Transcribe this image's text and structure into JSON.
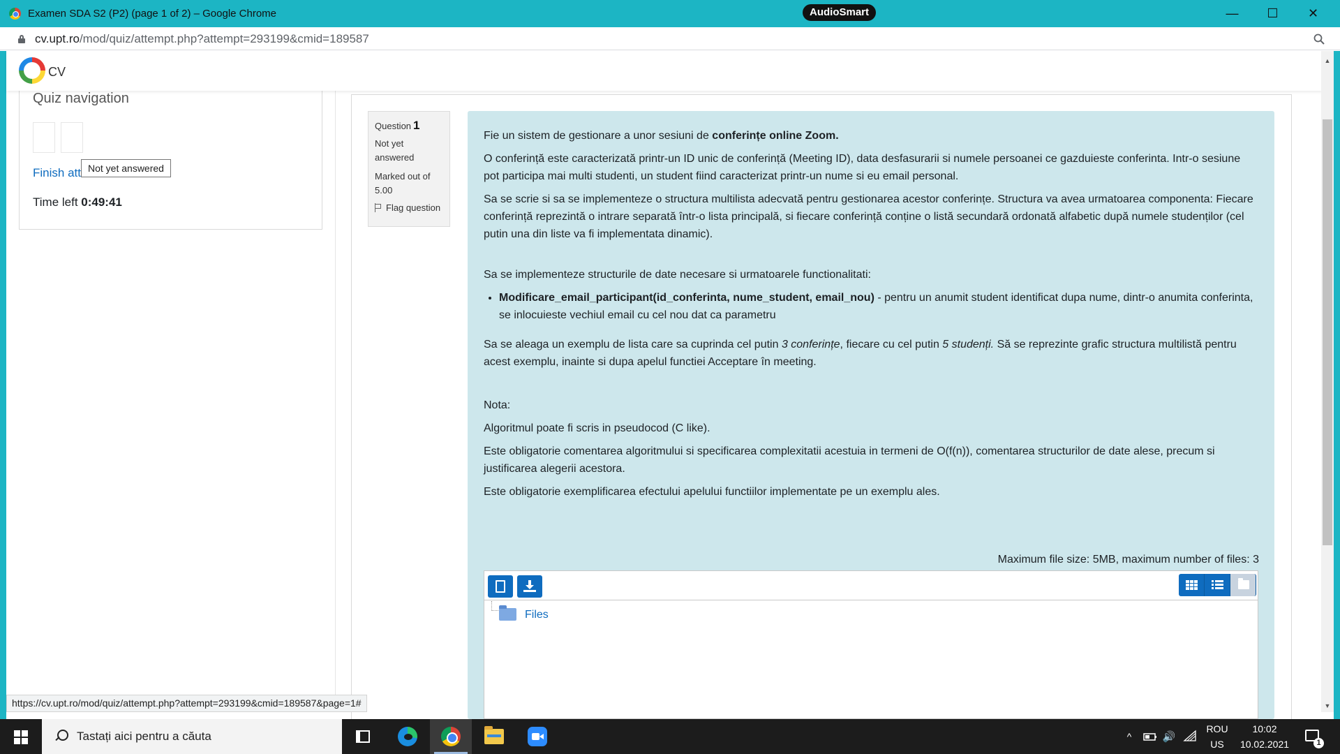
{
  "window": {
    "title": "Examen SDA S2 (P2) (page 1 of 2) – Google Chrome",
    "audiosmart": "AudioSmart",
    "minimize": "—",
    "maximize": "☐",
    "close": "✕"
  },
  "address": {
    "host": "cv.upt.ro",
    "path": "/mod/quiz/attempt.php?attempt=293199&cmid=189587"
  },
  "site": {
    "name": "CV"
  },
  "quiz_nav": {
    "heading": "Quiz navigation",
    "finish_label": "Finish attempt ...",
    "tooltip": "Not yet answered",
    "time_left_label": "Time left",
    "time_left_value": "0:49:41"
  },
  "question_info": {
    "label": "Question",
    "number": "1",
    "state": "Not yet answered",
    "grade": "Marked out of 5.00",
    "flag": "Flag question"
  },
  "question": {
    "p1_a": "Fie un sistem de gestionare a unor sesiuni de ",
    "p1_b": "conferințe online Zoom.",
    "p2": "O conferință este caracterizată printr-un ID unic de conferință (Meeting ID), data desfasurarii si numele persoanei ce gazduieste conferinta. Intr-o sesiune pot participa mai multi studenti, un student fiind caracterizat printr-un nume si eu email personal.",
    "p3": "Sa se scrie si sa se implementeze o structura multilista adecvată pentru gestionarea acestor conferințe. Structura va avea urmatoarea componenta: Fiecare conferință reprezintă o intrare separată într-o lista principală, si fiecare conferință conține o listă secundară ordonată alfabetic după numele studenților (cel putin una din liste va fi implementata dinamic).",
    "p4": "Sa se implementeze structurile de date necesare si urmatoarele functionalitati:",
    "li_bold": "Modificare_email_participant(id_conferinta, nume_student, email_nou)",
    "li_rest": " - pentru un anumit student identificat dupa nume, dintr-o anumita conferinta, se inlocuieste vechiul email cu cel nou dat ca parametru",
    "p5_a": "Sa se aleaga un exemplu de lista care sa cuprinda cel putin ",
    "p5_b": "3 conferințe",
    "p5_c": ", fiecare cu cel putin ",
    "p5_d": "5 studenți.",
    "p5_e": " Să se reprezinte grafic structura multilistă pentru acest exemplu, inainte si dupa apelul functiei Acceptare în meeting.",
    "nota": "Nota:",
    "p6": "Algoritmul poate fi scris in pseudocod (C like).",
    "p7": "Este obligatorie comentarea algoritmului si specificarea complexitatii acestuia in termeni de O(f(n)), comentarea structurilor de date alese, precum si justificarea alegerii acestora.",
    "p8": "Este obligatorie exemplificarea efectului apelului functiilor implementate pe un exemplu ales."
  },
  "filemanager": {
    "limits": "Maximum file size: 5MB, maximum number of files: 3",
    "folder": "Files"
  },
  "status_url": "https://cv.upt.ro/mod/quiz/attempt.php?attempt=293199&cmid=189587&page=1#",
  "taskbar": {
    "search_placeholder": "Tastați aici pentru a căuta",
    "lang_top": "ROU",
    "lang_bottom": "US",
    "time": "10:02",
    "date": "10.02.2021",
    "notifications": "1",
    "chevron": "^",
    "volume": "🔊"
  }
}
